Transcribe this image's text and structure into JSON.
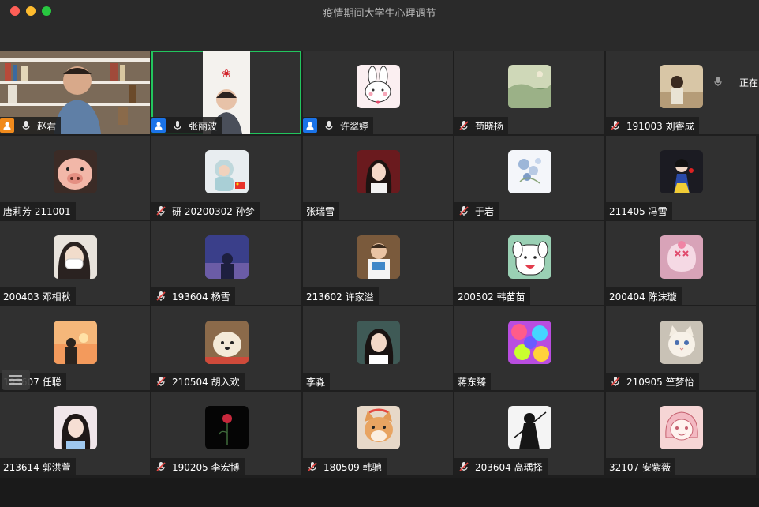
{
  "window": {
    "title": "疫情期间大学生心理调节"
  },
  "side_panel": {
    "text": "正在"
  },
  "colors": {
    "speaking_outline": "#22c55e",
    "host_orange": "#f08a1c",
    "host_blue": "#1a73e8",
    "muted_red": "#e0433f"
  },
  "participants": [
    {
      "name": "赵君",
      "host": "orange",
      "mic": "on",
      "media": "video-bookshelf"
    },
    {
      "name": "张丽波",
      "host": "blue",
      "mic": "on",
      "media": "video-portrait",
      "speaking": true
    },
    {
      "name": "许翠婷",
      "host": "blue",
      "mic": "on",
      "media": "bunny"
    },
    {
      "name": "苟晓扬",
      "mic": "muted",
      "media": "landscape"
    },
    {
      "name": "191003 刘睿成",
      "mic": "muted",
      "media": "portrait-warm"
    },
    {
      "name": "唐莉芳 211001",
      "mic": "none",
      "media": "pig"
    },
    {
      "name": "研 20200302 孙梦",
      "mic": "muted",
      "media": "baby"
    },
    {
      "name": "张瑞雪",
      "mic": "none",
      "media": "girl"
    },
    {
      "name": "于岩",
      "mic": "muted",
      "media": "flowers"
    },
    {
      "name": "211405 冯雪",
      "mic": "none",
      "media": "snow-white"
    },
    {
      "name": "200403 邓相秋",
      "mic": "none",
      "media": "mask-girl"
    },
    {
      "name": "193604 杨雪",
      "mic": "muted",
      "media": "night-sky"
    },
    {
      "name": "213602 许家溢",
      "mic": "none",
      "media": "boy"
    },
    {
      "name": "200502 韩苗苗",
      "mic": "none",
      "media": "cartoon-dog"
    },
    {
      "name": "200404 陈沫璇",
      "mic": "none",
      "media": "kuromi"
    },
    {
      "name": "193607 任聪",
      "mic": "none",
      "media": "sunset"
    },
    {
      "name": "210504 胡入欢",
      "mic": "muted",
      "media": "white-dog"
    },
    {
      "name": "李淼",
      "mic": "none",
      "media": "girl-hair"
    },
    {
      "name": "蒋东臻",
      "mic": "none",
      "media": "colorful"
    },
    {
      "name": "210905 竺梦怡",
      "mic": "muted",
      "media": "cat"
    },
    {
      "name": "213614 郭洪萱",
      "mic": "none",
      "media": "girl-pink"
    },
    {
      "name": "190205 李宏博",
      "mic": "muted",
      "media": "rose"
    },
    {
      "name": "180509 韩驰",
      "mic": "muted",
      "media": "shiba"
    },
    {
      "name": "203604 高瑀择",
      "mic": "muted",
      "media": "samurai"
    },
    {
      "name": "32107 安紫薇",
      "mic": "none",
      "media": "cartoon-girl"
    }
  ]
}
